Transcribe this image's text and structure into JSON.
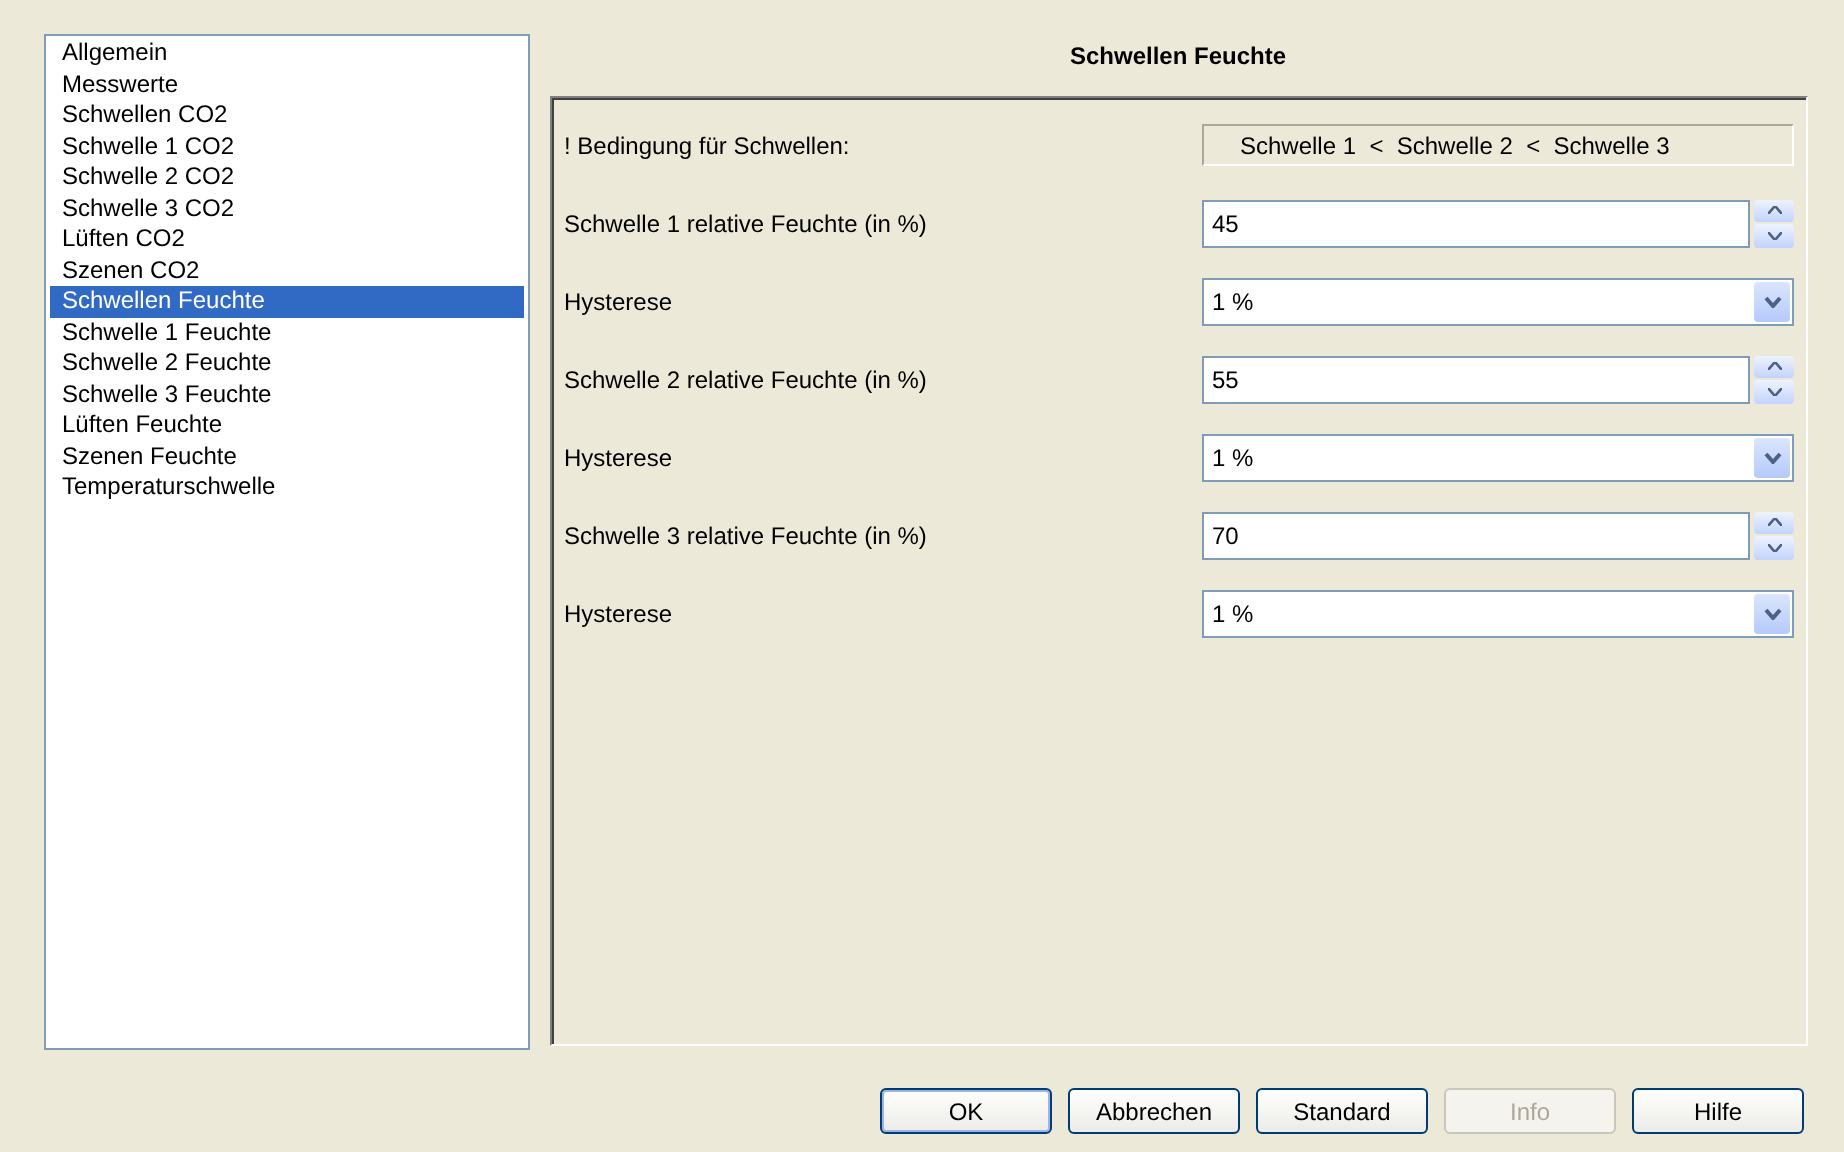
{
  "sidebar": {
    "items": [
      {
        "label": "Allgemein",
        "selected": false
      },
      {
        "label": "Messwerte",
        "selected": false
      },
      {
        "label": "Schwellen CO2",
        "selected": false
      },
      {
        "label": "Schwelle 1 CO2",
        "selected": false
      },
      {
        "label": "Schwelle 2 CO2",
        "selected": false
      },
      {
        "label": "Schwelle 3 CO2",
        "selected": false
      },
      {
        "label": "Lüften CO2",
        "selected": false
      },
      {
        "label": "Szenen CO2",
        "selected": false
      },
      {
        "label": "Schwellen Feuchte",
        "selected": true
      },
      {
        "label": "Schwelle 1 Feuchte",
        "selected": false
      },
      {
        "label": "Schwelle 2 Feuchte",
        "selected": false
      },
      {
        "label": "Schwelle 3 Feuchte",
        "selected": false
      },
      {
        "label": "Lüften Feuchte",
        "selected": false
      },
      {
        "label": "Szenen Feuchte",
        "selected": false
      },
      {
        "label": "Temperaturschwelle",
        "selected": false
      }
    ]
  },
  "panel": {
    "title": "Schwellen Feuchte",
    "rows": [
      {
        "kind": "info",
        "label": "! Bedingung für Schwellen:",
        "value": "Schwelle 1  <  Schwelle 2  <  Schwelle 3"
      },
      {
        "kind": "spin",
        "label": "Schwelle 1 relative Feuchte (in %)",
        "value": "45"
      },
      {
        "kind": "dropdown",
        "label": "Hysterese",
        "value": "1 %"
      },
      {
        "kind": "spin",
        "label": "Schwelle 2 relative Feuchte (in %)",
        "value": "55"
      },
      {
        "kind": "dropdown",
        "label": "Hysterese",
        "value": "1 %"
      },
      {
        "kind": "spin",
        "label": "Schwelle 3 relative Feuchte (in %)",
        "value": "70"
      },
      {
        "kind": "dropdown",
        "label": "Hysterese",
        "value": "1 %"
      }
    ]
  },
  "buttons": [
    {
      "label": "OK",
      "disabled": false,
      "default": true
    },
    {
      "label": "Abbrechen",
      "disabled": false,
      "default": false
    },
    {
      "label": "Standard",
      "disabled": false,
      "default": false
    },
    {
      "label": "Info",
      "disabled": true,
      "default": false
    },
    {
      "label": "Hilfe",
      "disabled": false,
      "default": false
    }
  ]
}
